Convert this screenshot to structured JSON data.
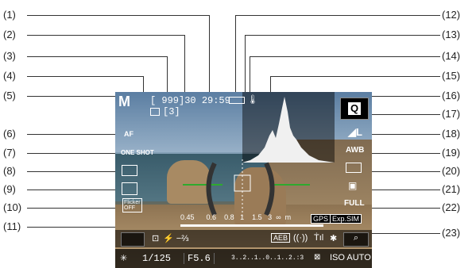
{
  "callouts_left": [
    "(1)",
    "(2)",
    "(3)",
    "(4)",
    "(5)",
    "(6)",
    "(7)",
    "(8)",
    "(9)",
    "(10)",
    "(11)"
  ],
  "callouts_right": [
    "(12)",
    "(13)",
    "(14)",
    "(15)",
    "(16)",
    "(17)",
    "(18)",
    "(19)",
    "(20)",
    "(21)",
    "(22)",
    "(23)"
  ],
  "osd": {
    "mode": "M",
    "af_mode": "AF",
    "one_shot": "ONE SHOT",
    "flicker": "Flicker",
    "flicker_state": "OFF",
    "shots": "999",
    "time": "30 29:59",
    "drive_count": "[3]",
    "scale": [
      "0.45",
      "0.6",
      "0.8",
      "1",
      "1.5",
      "3",
      "∞",
      "m"
    ],
    "gps": "GPS",
    "exp_sim": "Exp.SIM",
    "flash_comp": "−⅔",
    "aeb": "AEB",
    "shutter": "1/125",
    "aperture": "F5.6",
    "exposure_scale": "3..2..1..0..1..2.:3",
    "iso": "AUTO",
    "quality": "FULL",
    "wb": "AWB",
    "q_label": "Q"
  },
  "colors": {
    "frame": "#ffffff",
    "histogram": "#f0f0f0",
    "level_line": "#2eaa2e"
  }
}
